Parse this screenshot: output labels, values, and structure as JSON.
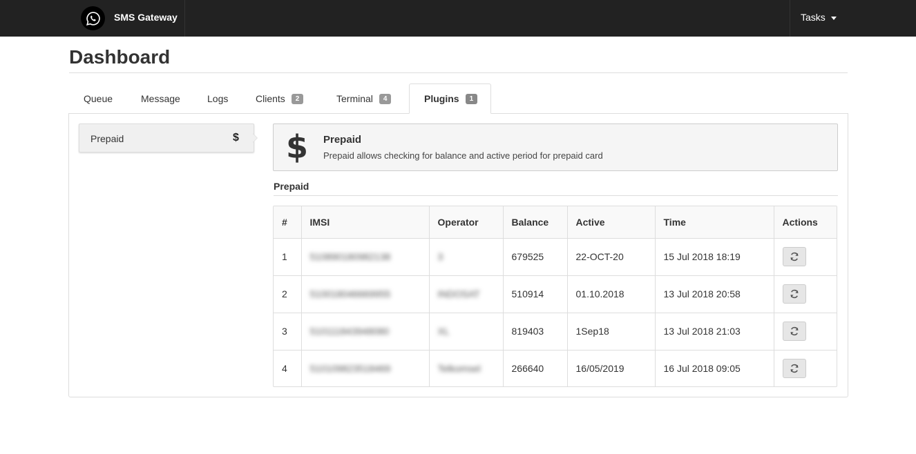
{
  "navbar": {
    "brand": "SMS Gateway",
    "brand_icon": "whatsapp-icon",
    "tasks_label": "Tasks"
  },
  "page": {
    "title": "Dashboard"
  },
  "tabs": [
    {
      "label": "Queue",
      "badge": null
    },
    {
      "label": "Message",
      "badge": null
    },
    {
      "label": "Logs",
      "badge": null
    },
    {
      "label": "Clients",
      "badge": "2"
    },
    {
      "label": "Terminal",
      "badge": "4"
    },
    {
      "label": "Plugins",
      "badge": "1",
      "active": true
    }
  ],
  "sidebar": {
    "items": [
      {
        "label": "Prepaid",
        "icon": "dollar-icon",
        "icon_glyph": "$"
      }
    ]
  },
  "plugin": {
    "icon_glyph": "$",
    "title": "Prepaid",
    "description": "Prepaid allows checking for balance and active period for prepaid card"
  },
  "section": {
    "title": "Prepaid"
  },
  "table": {
    "columns": [
      "#",
      "IMSI",
      "Operator",
      "Balance",
      "Active",
      "Time",
      "Actions"
    ],
    "rows": [
      {
        "num": "1",
        "imsi": "510890180982138",
        "operator": "3",
        "balance": "679525",
        "active": "22-OCT-20",
        "time": "15 Jul 2018 18:19"
      },
      {
        "num": "2",
        "imsi": "510018046669955",
        "operator": "INDOSAT",
        "balance": "510914",
        "active": "01.10.2018",
        "time": "13 Jul 2018 20:58"
      },
      {
        "num": "3",
        "imsi": "510111843948080",
        "operator": "XL",
        "balance": "819403",
        "active": "1Sep18",
        "time": "13 Jul 2018 21:03"
      },
      {
        "num": "4",
        "imsi": "510109823518469",
        "operator": "Telkomsel",
        "balance": "266640",
        "active": "16/05/2019",
        "time": "16 Jul 2018 09:05"
      }
    ]
  },
  "colors": {
    "navbar_bg": "#222222",
    "active_tab_text": "#333333",
    "badge_bg": "#999999"
  }
}
